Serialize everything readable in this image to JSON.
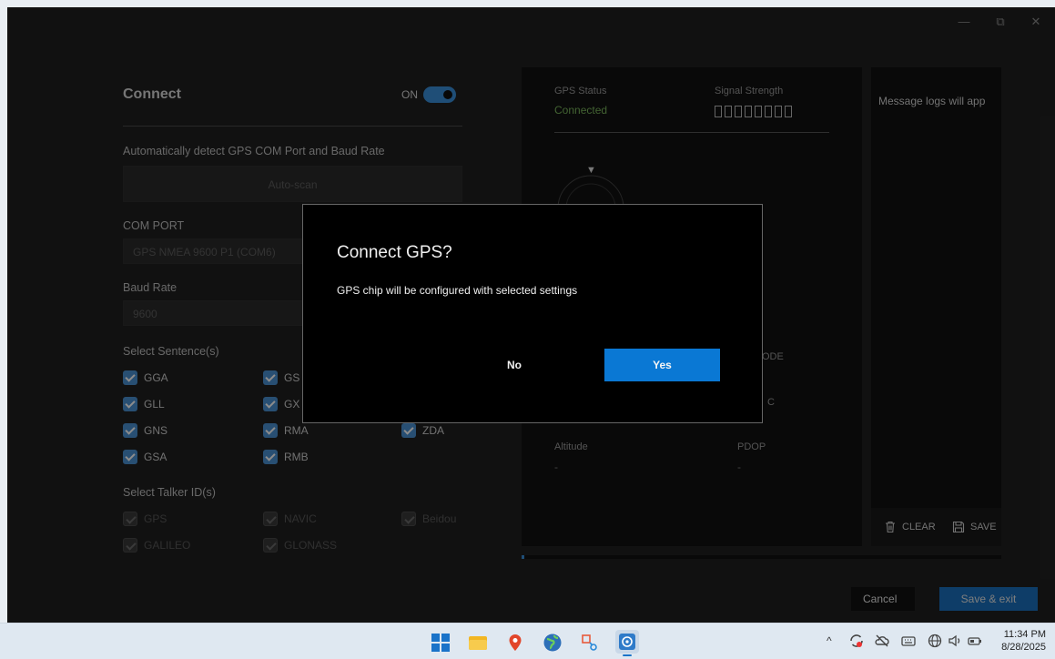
{
  "connect": {
    "title": "Connect",
    "toggle_label": "ON",
    "auto_detect_label": "Automatically detect GPS COM Port and Baud Rate",
    "autoscan_label": "Auto-scan",
    "com_port_label": "COM PORT",
    "com_port_value": "GPS NMEA 9600 P1 (COM6)",
    "baud_rate_label": "Baud Rate",
    "baud_rate_value": "9600",
    "sentences_label": "Select Sentence(s)",
    "sentences": [
      "GGA",
      "GS",
      "GLL",
      "GX",
      "GNS",
      "RMA",
      "ZDA",
      "GSA",
      "RMB"
    ],
    "talker_label": "Select Talker ID(s)",
    "talkers": [
      "GPS",
      "NAVIC",
      "Beidou",
      "GALILEO",
      "GLONASS"
    ]
  },
  "status": {
    "gps_status_label": "GPS Status",
    "gps_status_value": "Connected",
    "gps_status_color": "#7ab55c",
    "signal_label": "Signal Strength",
    "signal_bars": 8,
    "compass_n": "▼",
    "mode_label": "ODE",
    "acc_label": "C",
    "altitude_label": "Altitude",
    "altitude_value": "-",
    "pdop_label": "PDOP",
    "pdop_value": "-"
  },
  "logs": {
    "placeholder": "Message logs will app",
    "clear_label": "CLEAR",
    "save_label": "SAVE"
  },
  "footer": {
    "cancel_label": "Cancel",
    "save_exit_label": "Save & exit"
  },
  "dialog": {
    "title": "Connect GPS?",
    "message": "GPS chip will be configured with selected settings",
    "no_label": "No",
    "yes_label": "Yes"
  },
  "taskbar": {
    "time": "11:34 PM",
    "date": "8/28/2025",
    "tray_chevron": "^"
  },
  "window": {
    "minimize": "—",
    "restore": "⧉",
    "close": "✕"
  }
}
